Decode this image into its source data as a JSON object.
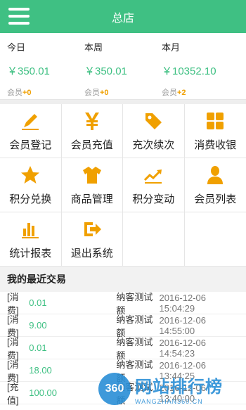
{
  "header": {
    "title": "总店",
    "menu_icon": "hamburger-menu-icon"
  },
  "stats": [
    {
      "label": "今日",
      "value": "￥350.01",
      "member_prefix": "会员",
      "member_delta": "+0"
    },
    {
      "label": "本周",
      "value": "￥350.01",
      "member_prefix": "会员",
      "member_delta": "+0"
    },
    {
      "label": "本月",
      "value": "￥10352.10",
      "member_prefix": "会员",
      "member_delta": "+2"
    }
  ],
  "menu": [
    {
      "label": "会员登记",
      "icon": "pencil-icon"
    },
    {
      "label": "会员充值",
      "icon": "yen-icon"
    },
    {
      "label": "充次续次",
      "icon": "tag-icon"
    },
    {
      "label": "消费收银",
      "icon": "grid-icon"
    },
    {
      "label": "积分兑换",
      "icon": "star-icon"
    },
    {
      "label": "商品管理",
      "icon": "shirt-icon"
    },
    {
      "label": "积分变动",
      "icon": "trend-icon"
    },
    {
      "label": "会员列表",
      "icon": "person-icon"
    },
    {
      "label": "统计报表",
      "icon": "bar-chart-icon"
    },
    {
      "label": "退出系统",
      "icon": "exit-icon"
    }
  ],
  "recent": {
    "title": "我的最近交易",
    "rows": [
      {
        "type": "[消费]",
        "amount": "0.01",
        "name": "纳客测试额",
        "time": "2016-12-06 15:04:29"
      },
      {
        "type": "[消费]",
        "amount": "9.00",
        "name": "纳客测试额",
        "time": "2016-12-06 14:55:00"
      },
      {
        "type": "[消费]",
        "amount": "0.01",
        "name": "纳客测试额",
        "time": "2016-12-06 14:54:23"
      },
      {
        "type": "[消费]",
        "amount": "18.00",
        "name": "纳客测试额",
        "time": "2016-12-06 13:44:25"
      },
      {
        "type": "[充值]",
        "amount": "100.00",
        "name": "纳客测试额",
        "time": "2016-12-06 13:40:00"
      }
    ]
  },
  "watermark": {
    "badge": "360",
    "main": "网站排行榜",
    "sub": "WANGZHAN360.CN"
  },
  "colors": {
    "accent": "#3fc083",
    "icon": "#f0a000",
    "watermark": "#2a8fd6"
  }
}
